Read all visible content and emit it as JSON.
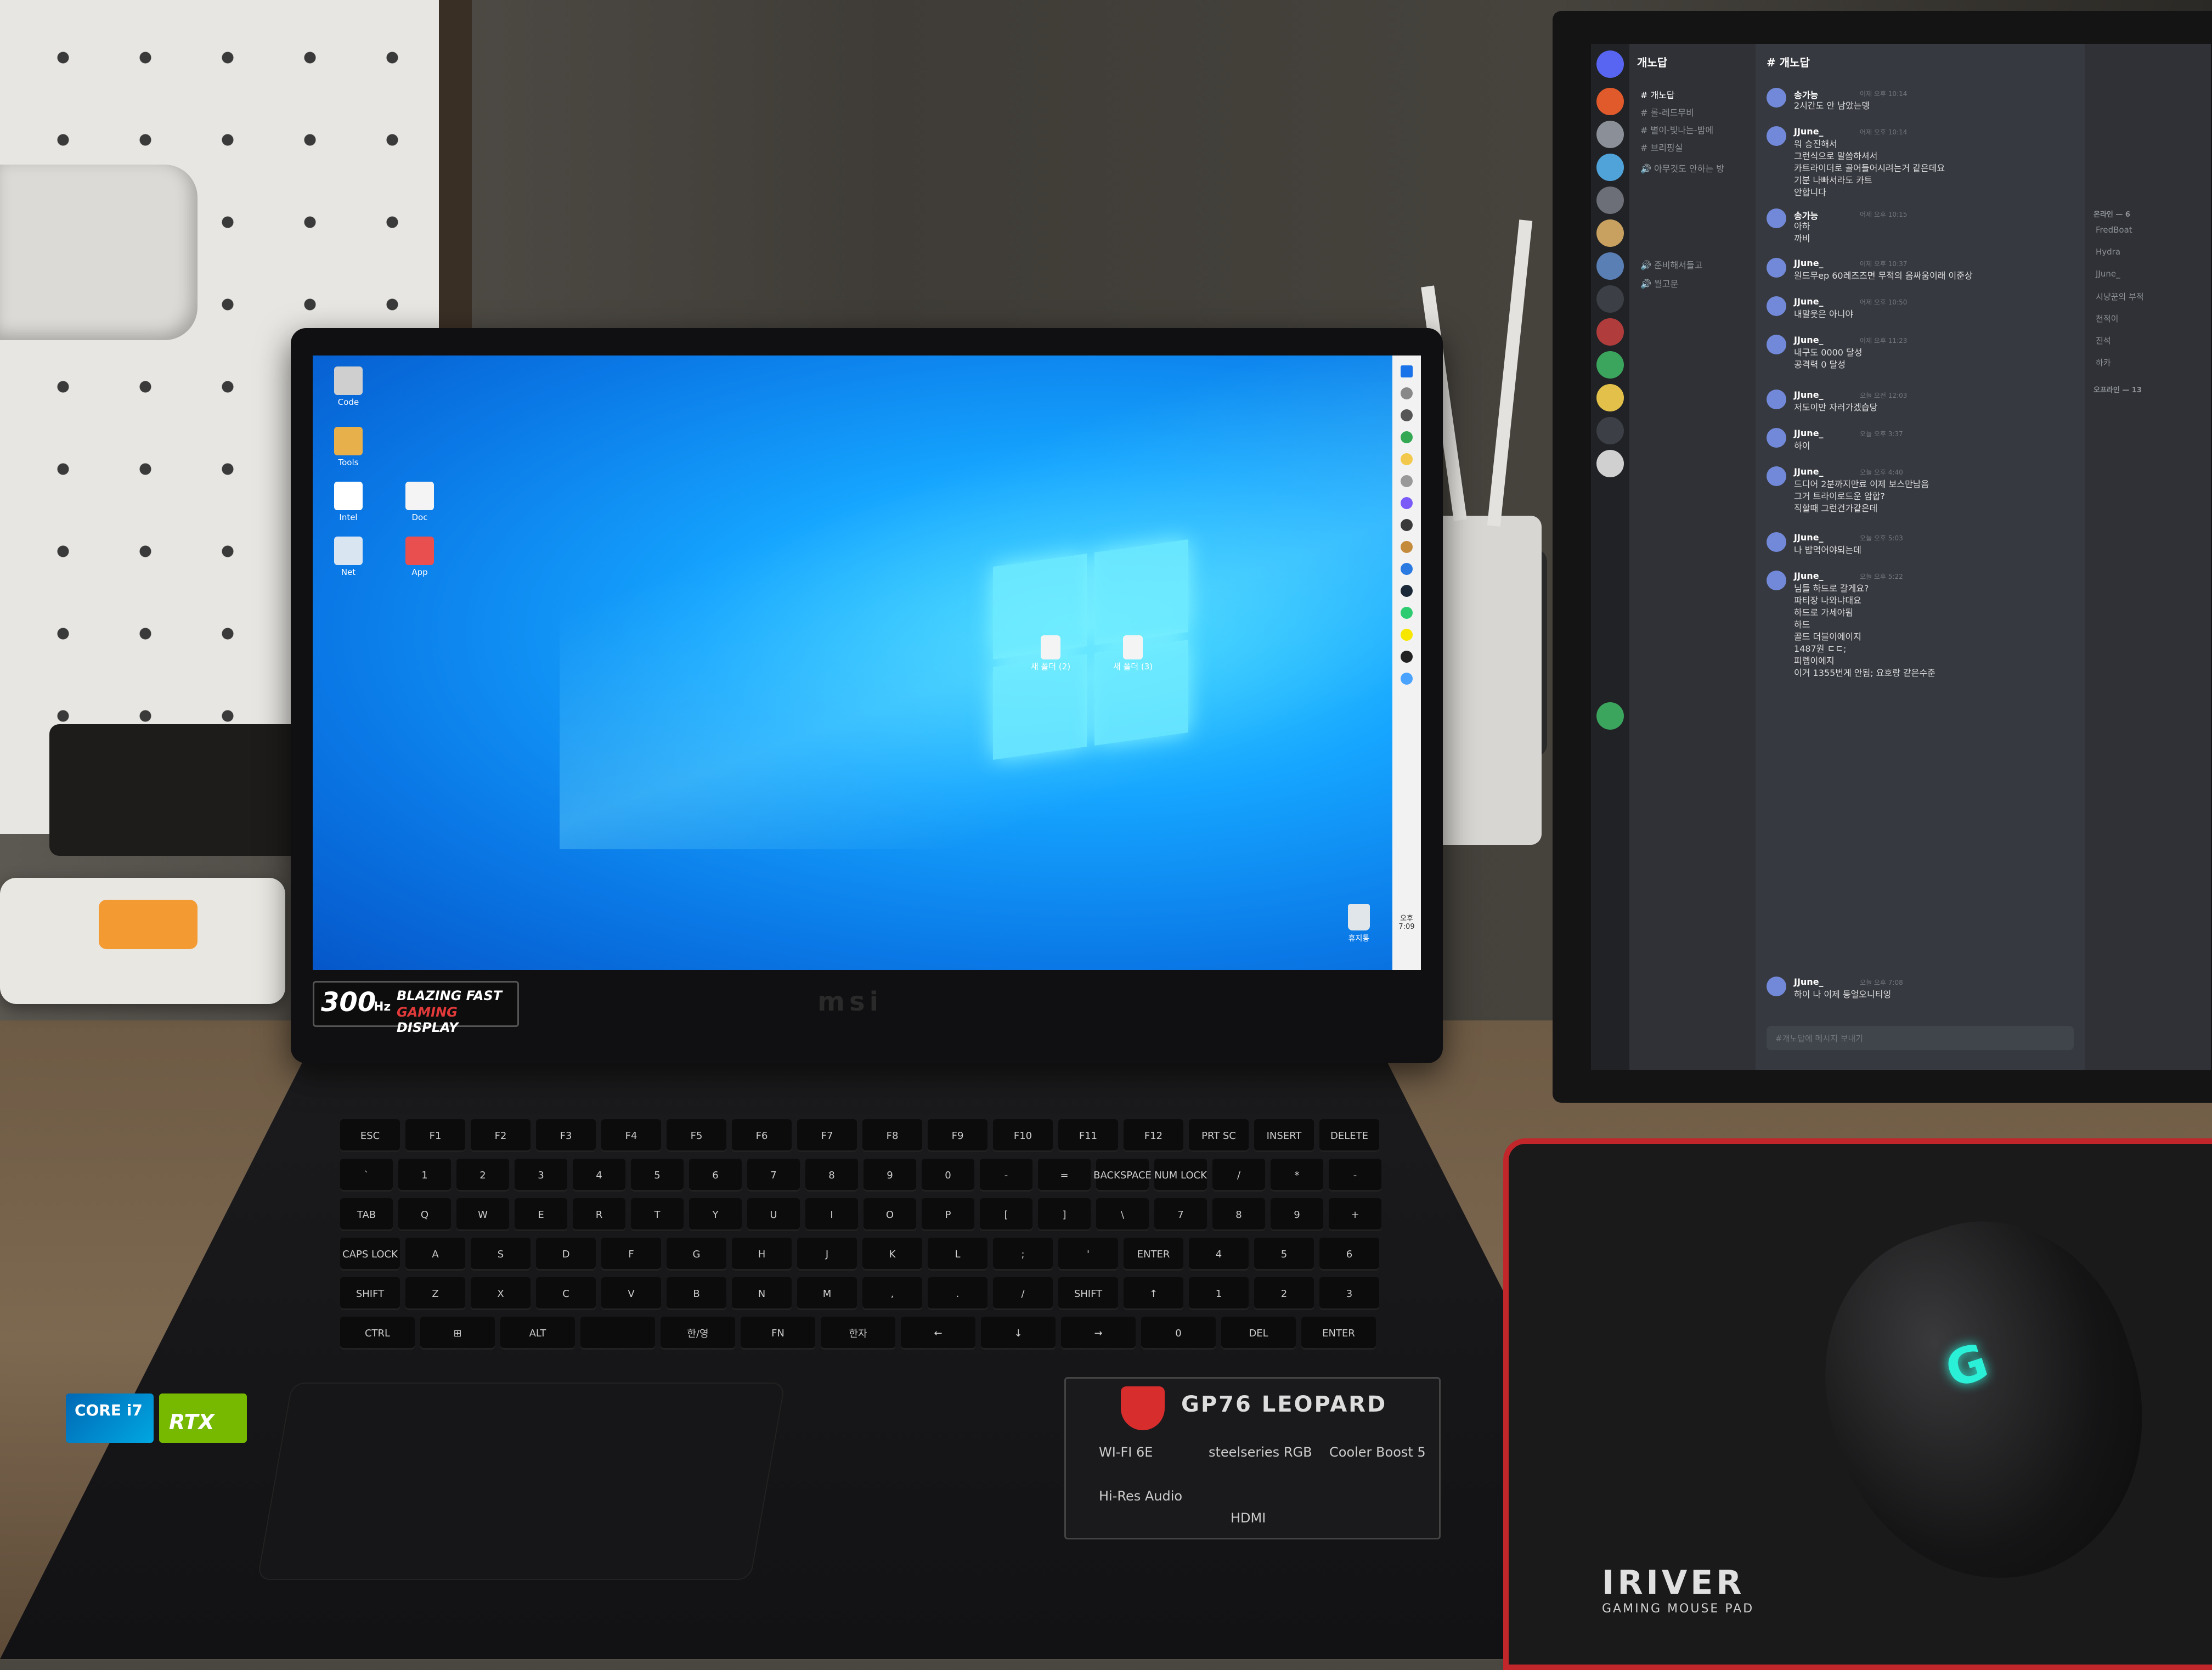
{
  "laptop": {
    "desktop_icons": [
      {
        "label": "Code"
      },
      {
        "label": "Tools"
      },
      {
        "label": "Intel"
      },
      {
        "label": "Doc"
      },
      {
        "label": "Net"
      },
      {
        "label": "App"
      }
    ],
    "center_files": [
      "새 폴더 (2)",
      "새 폴더 (3)"
    ],
    "tray_time": "오후 7:09",
    "recycle_bin": "휴지통",
    "badge": {
      "hz": "300",
      "unit": "Hz",
      "line1": "BLAZING FAST",
      "line2a": "GAMING",
      "line2b": " DISPLAY"
    },
    "brand": "msi",
    "model": "GP76 LEOPARD",
    "sticker_labels": [
      "WI-FI 6E",
      "steelseries RGB",
      "Cooler Boost 5",
      "Hi-Res Audio",
      "HDMI"
    ],
    "intel_label": "CORE i7",
    "nvidia_label": "RTX"
  },
  "keyboard": {
    "row1": [
      "ESC",
      "F1",
      "F2",
      "F3",
      "F4",
      "F5",
      "F6",
      "F7",
      "F8",
      "F9",
      "F10",
      "F11",
      "F12",
      "PRT SC",
      "INSERT",
      "DELETE"
    ],
    "row2": [
      "`",
      "1",
      "2",
      "3",
      "4",
      "5",
      "6",
      "7",
      "8",
      "9",
      "0",
      "-",
      "=",
      "BACKSPACE",
      "NUM LOCK",
      "/",
      "*",
      "-"
    ],
    "row3": [
      "TAB",
      "Q",
      "W",
      "E",
      "R",
      "T",
      "Y",
      "U",
      "I",
      "O",
      "P",
      "[",
      "]",
      "\\",
      "7",
      "8",
      "9",
      "+"
    ],
    "row4": [
      "CAPS LOCK",
      "A",
      "S",
      "D",
      "F",
      "G",
      "H",
      "J",
      "K",
      "L",
      ";",
      "'",
      "ENTER",
      "4",
      "5",
      "6"
    ],
    "row5": [
      "SHIFT",
      "Z",
      "X",
      "C",
      "V",
      "B",
      "N",
      "M",
      ",",
      ".",
      "/",
      "SHIFT",
      "↑",
      "1",
      "2",
      "3"
    ],
    "row6": [
      "CTRL",
      "⊞",
      "ALT",
      "",
      "한/영",
      "FN",
      "한자",
      "←",
      "↓",
      "→",
      "0",
      "DEL",
      "ENTER"
    ]
  },
  "discord": {
    "app": "Discord",
    "server": "개노답",
    "channels": [
      {
        "name": "# 개노답",
        "active": true
      },
      {
        "name": "# 롤-레드무비",
        "active": false
      },
      {
        "name": "# 별이-빛나는-밤에",
        "active": false
      },
      {
        "name": "# 브리핑실",
        "active": false
      },
      {
        "name": "🔊 아무것도 안하는 방",
        "active": false
      },
      {
        "name": "🔊 준비해서들고",
        "active": false
      },
      {
        "name": "🔊 월고문",
        "active": false
      }
    ],
    "chat_title": "# 개노답",
    "messages": [
      {
        "name": "송가능",
        "time": "어제 오후 10:14",
        "text": "2시간도 안 남았는뎅"
      },
      {
        "name": "JJune_",
        "time": "어제 오후 10:14",
        "text": "워 승진해서\n그런식으로 말씀하셔서\n카트라이더로 골어들어시려는거 같은데요\n기분 나빠서라도 카트\n안합니다"
      },
      {
        "name": "송가능",
        "time": "어제 오후 10:15",
        "text": "아하\n까비"
      },
      {
        "name": "JJune_",
        "time": "어제 오후 10:37",
        "text": "원드무ep 60레즈즈면 무적의 음싸움이래 이준상"
      },
      {
        "name": "JJune_",
        "time": "어제 오후 10:50",
        "text": "내말웃은 아니야"
      },
      {
        "name": "JJune_",
        "time": "어제 오후 11:23",
        "text": "내구도 0000 달성\n공격력 0 달성"
      },
      {
        "name": "JJune_",
        "time": "오늘 오전 12:03",
        "text": "저도이만 자러가겠습당"
      },
      {
        "name": "JJune_",
        "time": "오늘 오후 3:37",
        "text": "하이"
      },
      {
        "name": "JJune_",
        "time": "오늘 오후 4:40",
        "text": "드디어 2분까지만료 이제 보스만남음\n그거 트라이로드운 암합?\n직할때 그런건가같은데"
      },
      {
        "name": "JJune_",
        "time": "오늘 오후 5:03",
        "text": "나 밥먹어야되는데"
      },
      {
        "name": "JJune_",
        "time": "오늘 오후 5:22",
        "text": "님들 하드로 갈게요?\n파티장 나와냐대요\n하드로 가세야됨\n하드\n골드 더블이에이지\n1487원 ㄷㄷ;\n피렙이에지\n이거 1355번게 안됨; 요호랑 같은수준"
      },
      {
        "name": "JJune_",
        "time": "오늘 오후 7:08",
        "text": "하이 나 이제 등얼오니티잉"
      }
    ],
    "input_placeholder": "#개노답에 메시지 보내기",
    "members_header_online": "온라인 — 6",
    "members": [
      "FredBoat",
      "Hydra",
      "JJune_",
      "시냥꾼의 부적",
      "천적이",
      "진석",
      "하카"
    ],
    "members_header_offline": "오프라인 — 13"
  },
  "mousepad": {
    "brand": "IRIVER",
    "subtitle": "GAMING MOUSE PAD"
  },
  "mouse_logo": "G",
  "colors": {
    "windows_blue": "#0a78e6",
    "discord_bg": "#36393f",
    "mousepad_trim": "#c0262a",
    "mouse_glow": "#2bf0d8"
  }
}
